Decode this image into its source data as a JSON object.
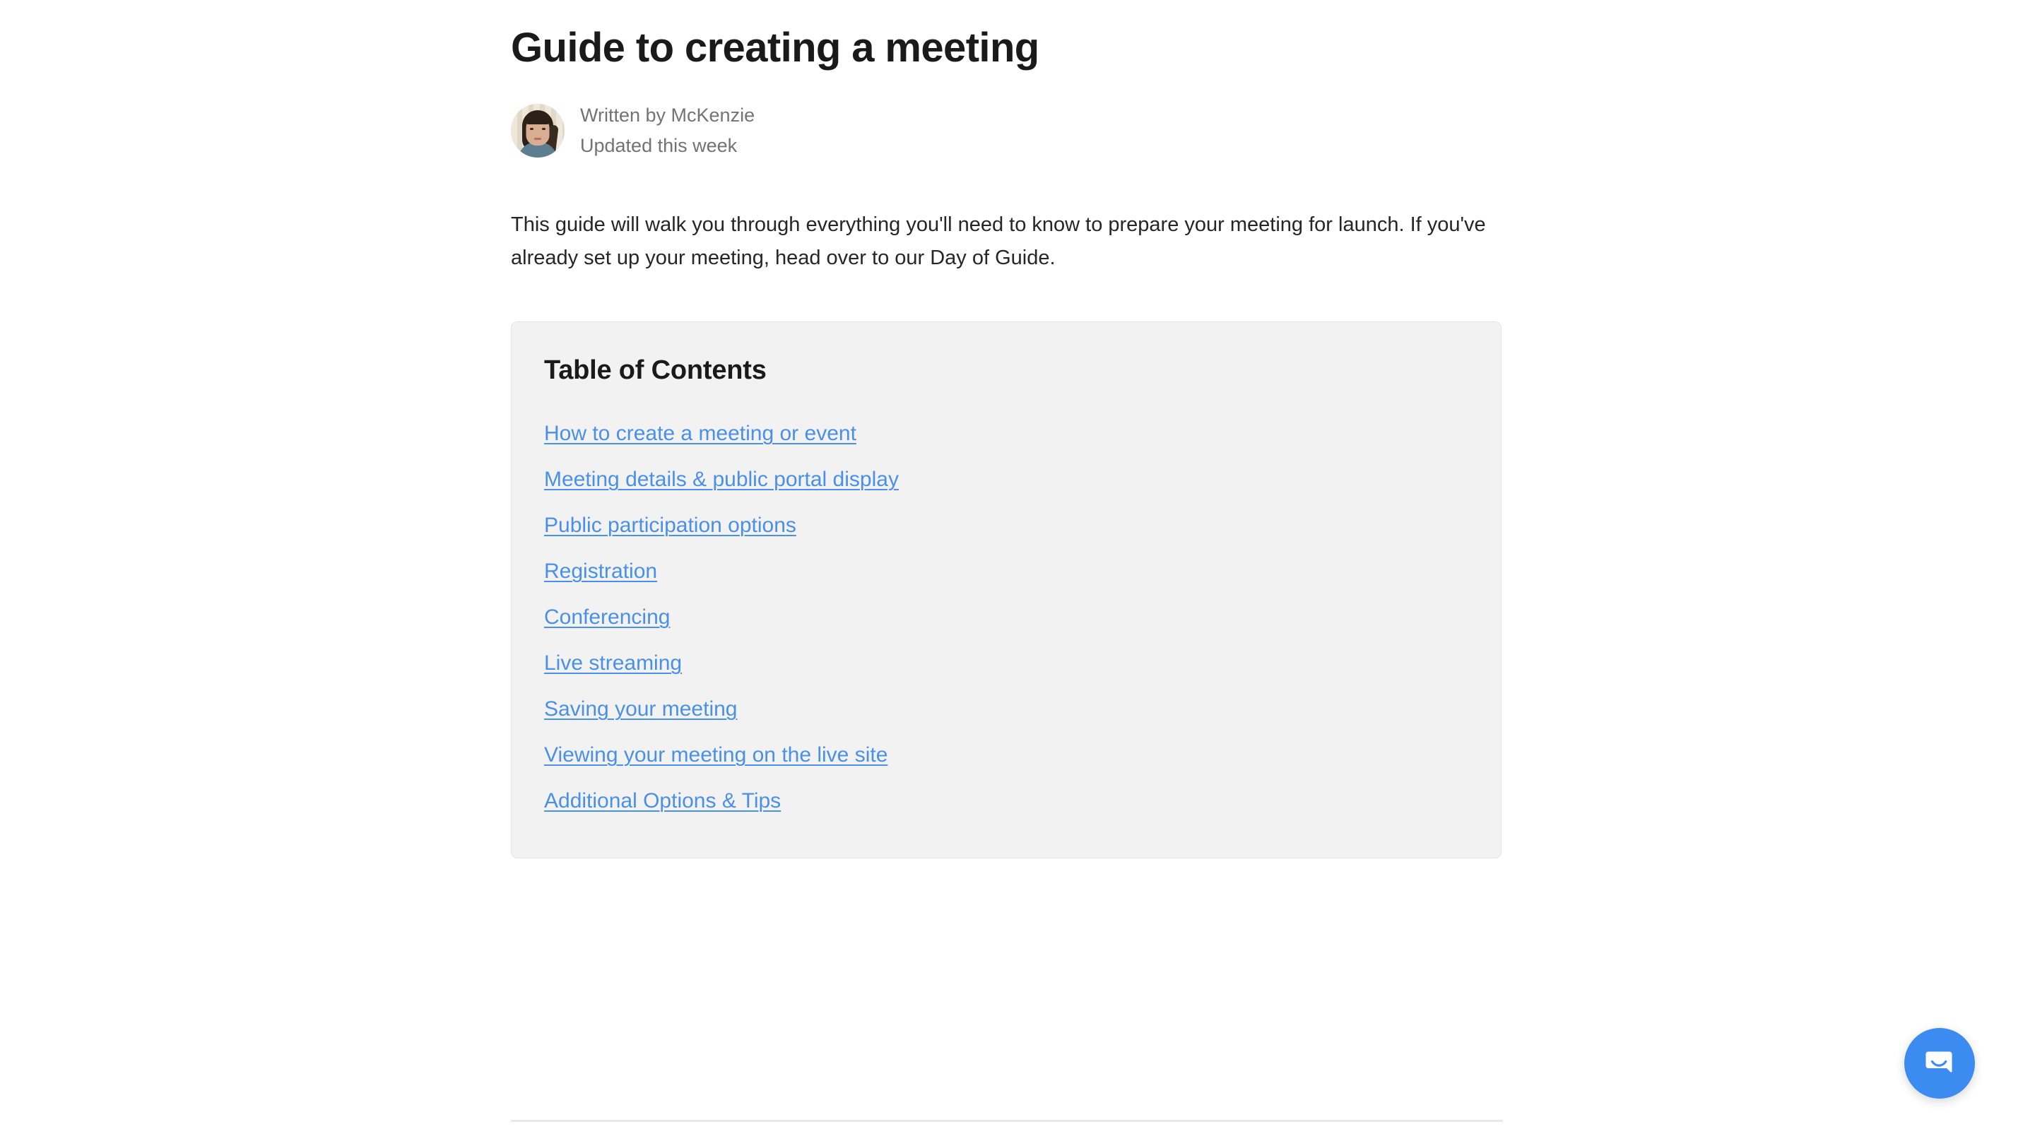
{
  "article": {
    "title": "Guide to creating a meeting",
    "author": {
      "avatar_icon": "user-avatar-photo",
      "written_by": "Written by McKenzie",
      "updated": "Updated this week"
    },
    "intro": "This guide will walk you through everything you'll need to know to prepare your meeting for launch. If you've already set up your meeting, head over to our Day of Guide."
  },
  "toc": {
    "heading": "Table of Contents",
    "links": [
      {
        "label": "How to create a meeting or event"
      },
      {
        "label": "Meeting details & public portal display"
      },
      {
        "label": "Public participation options"
      },
      {
        "label": "Registration"
      },
      {
        "label": "Conferencing"
      },
      {
        "label": "Live streaming"
      },
      {
        "label": "Saving your meeting"
      },
      {
        "label": "Viewing your meeting on the live site"
      },
      {
        "label": "Additional Options & Tips"
      }
    ]
  },
  "messenger": {
    "icon": "intercom-chat-bubble-icon",
    "color": "#3b8bf0"
  },
  "colors": {
    "link": "#4a90e8",
    "heading": "#1a1a1a",
    "body_text": "#262626",
    "muted_text": "#737373",
    "card_background": "#f2f2f2",
    "card_border": "#e4e4e4",
    "divider": "#e8e8e8",
    "page_background": "#ffffff"
  }
}
